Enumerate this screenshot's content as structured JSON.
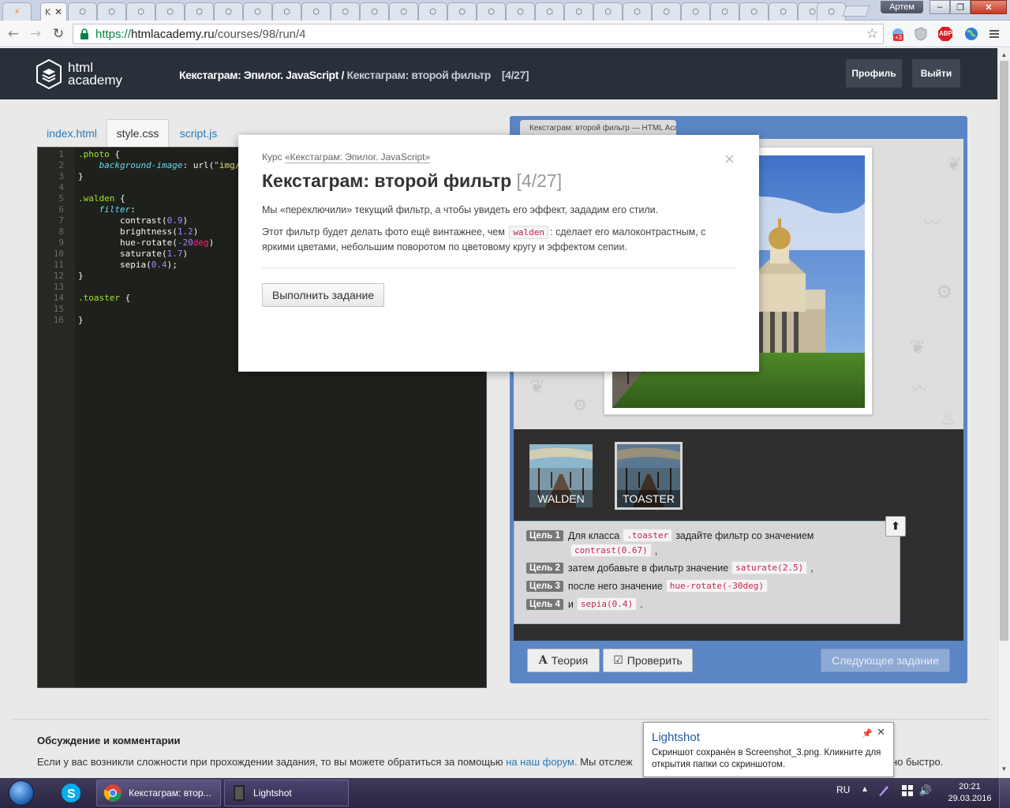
{
  "browser": {
    "url_scheme": "https://",
    "url_host": "htmlacademy.ru",
    "url_path": "/courses/98/run/4",
    "user_name": "Артем",
    "active_tab_letter": "K",
    "ext_badge": "+3",
    "abp_label": "ABP"
  },
  "site": {
    "logo_line1": "html",
    "logo_line2": "academy",
    "breadcrumb_course": "Кекстаграм: Эпилог. JavaScript",
    "breadcrumb_sep": " / ",
    "breadcrumb_current": "Кекстаграм: второй фильтр",
    "breadcrumb_counter": "[4/27]",
    "profile_btn": "Профиль",
    "logout_btn": "Выйти"
  },
  "editor": {
    "tabs": [
      "index.html",
      "style.css",
      "script.js"
    ],
    "active_tab": "style.css",
    "line_numbers": [
      "1",
      "2",
      "3",
      "4",
      "5",
      "6",
      "7",
      "8",
      "9",
      "10",
      "11",
      "12",
      "13",
      "14",
      "15",
      "16"
    ]
  },
  "preview": {
    "tab_title": "Кекстаграм: второй фильтр — HTML Academy",
    "filters": [
      {
        "label": "WALDEN",
        "selected": false
      },
      {
        "label": "TOASTER",
        "selected": true
      }
    ],
    "goals": [
      {
        "badge": "Цель 1",
        "prefix": "Для класса",
        "code1": ".toaster",
        "mid": "задайте фильтр со значением",
        "code2": "contrast(0.67)",
        "suffix": ","
      },
      {
        "badge": "Цель 2",
        "prefix": "затем добавьте в фильтр значение",
        "code1": "saturate(2.5)",
        "suffix": ","
      },
      {
        "badge": "Цель 3",
        "prefix": "после него значение",
        "code1": "hue-rotate(-30deg)"
      },
      {
        "badge": "Цель 4",
        "prefix": "и",
        "code1": "sepia(0.4)",
        "suffix": "."
      }
    ],
    "theory_btn": "Теория",
    "check_btn": "Проверить",
    "next_btn": "Следующее задание"
  },
  "modal": {
    "course_prefix": "Курс ",
    "course_name": "«Кекстаграм: Эпилог. JavaScript»",
    "title": "Кекстаграм: второй фильтр",
    "title_counter": "[4/27]",
    "p1": "Мы «переключили» текущий фильтр, а чтобы увидеть его эффект, зададим его стили.",
    "p2_before": "Этот фильтр будет делать фото ещё винтажнее, чем",
    "p2_code": "walden",
    "p2_after": ": сделает его малоконтрастным, с яркими цветами, небольшим поворотом по цветовому кругу и эффектом сепии.",
    "button": "Выполнить задание",
    "close_glyph": "×"
  },
  "comments": {
    "title": "Обсуждение и комментарии",
    "text_before": "Если у вас возникли сложности при прохождении задания, то вы можете обратиться за помощью ",
    "link": "на наш форум.",
    "text_after": " Мы отслеж",
    "tail": "но быстро."
  },
  "notification": {
    "title": "Lightshot",
    "body": "Скриншот сохранён в Screenshot_3.png. Кликните для открытия папки со скриншотом."
  },
  "taskbar": {
    "chrome_task": "Кекстаграм: втор...",
    "lightshot_task": "Lightshot",
    "lang": "RU",
    "time": "20:21",
    "date": "29.03.2016"
  },
  "colors": {
    "site_header": "#283039",
    "preview_frame": "#5b85c5",
    "editor_bg": "#1e201c",
    "link": "#2a7ab5",
    "code_inline": "#c7254e"
  }
}
